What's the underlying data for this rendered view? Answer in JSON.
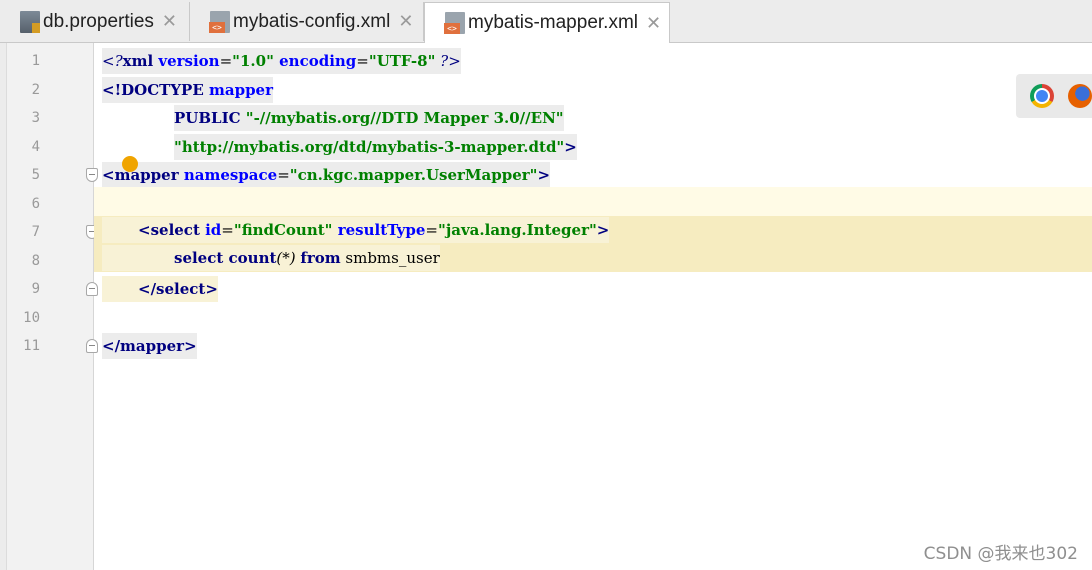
{
  "tabs": [
    {
      "label": "db.properties",
      "icon": "properties-file-icon",
      "active": false
    },
    {
      "label": "mybatis-config.xml",
      "icon": "xml-file-icon",
      "active": false
    },
    {
      "label": "mybatis-mapper.xml",
      "icon": "xml-file-icon",
      "active": true
    }
  ],
  "tab_close_glyph": "✕",
  "line_numbers": [
    "1",
    "2",
    "3",
    "4",
    "5",
    "6",
    "7",
    "8",
    "9",
    "10",
    "11"
  ],
  "code": {
    "l1": {
      "open": "<?",
      "name": "xml",
      "a1": " version",
      "eq1": "=",
      "v1": "\"1.0\"",
      "a2": " encoding",
      "eq2": "=",
      "v2": "\"UTF-8\"",
      "close": " ?>"
    },
    "l2": {
      "open": "<!",
      "kw": "DOCTYPE",
      "name": " mapper"
    },
    "l3": {
      "kw": "PUBLIC",
      "val": " \"-//mybatis.org//DTD Mapper 3.0//EN\""
    },
    "l4": {
      "val": "\"http://mybatis.org/dtd/mybatis-3-mapper.dtd\"",
      "close": ">"
    },
    "l5": {
      "open": "<",
      "name": "mapper",
      "a1": " namespace",
      "eq1": "=",
      "v1": "\"cn.kgc.mapper.UserMapper\"",
      "close": ">"
    },
    "l7": {
      "open": "<",
      "name": "select",
      "a1": " id",
      "eq1": "=",
      "v1": "\"findCount\"",
      "a2": " resultType",
      "eq2": "=",
      "v2": "\"java.lang.Integer\"",
      "close": ">"
    },
    "l8": {
      "kw1": "select",
      "kw2": " count",
      "rest": "(*) ",
      "kw3": "from",
      "tail": " smbms_user"
    },
    "l9": {
      "open": "</",
      "name": "select",
      "close": ">"
    },
    "l11": {
      "open": "</",
      "name": "mapper",
      "close": ">"
    }
  },
  "watermark": "CSDN @我来也302"
}
